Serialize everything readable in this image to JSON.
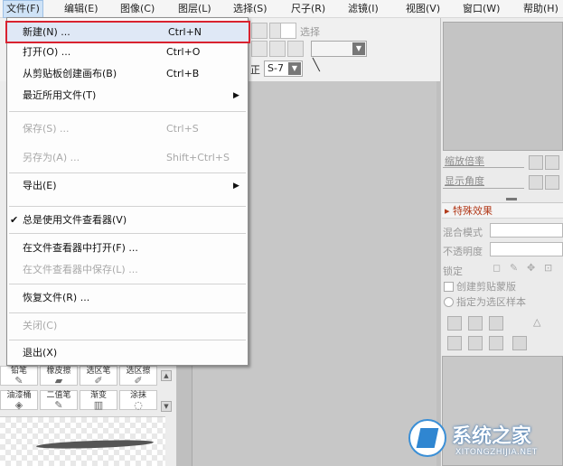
{
  "menubar": {
    "items": [
      "文件(F)",
      "编辑(E)",
      "图像(C)",
      "图层(L)",
      "选择(S)",
      "尺子(R)",
      "滤镜(I)",
      "视图(V)",
      "窗口(W)",
      "帮助(H)"
    ]
  },
  "toolbar": {
    "select_label": "选择",
    "zheng_label": "正",
    "size_value": "S-7"
  },
  "file_menu": {
    "items": [
      {
        "label": "新建(N) ...",
        "shortcut": "Ctrl+N",
        "state": "highlighted"
      },
      {
        "label": "打开(O) ...",
        "shortcut": "Ctrl+O",
        "state": "enabled"
      },
      {
        "label": "从剪贴板创建画布(B)",
        "shortcut": "Ctrl+B",
        "state": "enabled"
      },
      {
        "label": "最近所用文件(T)",
        "shortcut": "",
        "state": "submenu"
      },
      {
        "label": "保存(S) ...",
        "shortcut": "Ctrl+S",
        "state": "disabled"
      },
      {
        "label": "另存为(A) ...",
        "shortcut": "Shift+Ctrl+S",
        "state": "disabled"
      },
      {
        "label": "导出(E)",
        "shortcut": "",
        "state": "submenu"
      },
      {
        "label": "总是使用文件查看器(V)",
        "shortcut": "",
        "state": "checked"
      },
      {
        "label": "在文件查看器中打开(F) ...",
        "shortcut": "",
        "state": "enabled"
      },
      {
        "label": "在文件查看器中保存(L) ...",
        "shortcut": "",
        "state": "disabled"
      },
      {
        "label": "恢复文件(R) ...",
        "shortcut": "",
        "state": "enabled"
      },
      {
        "label": "关闭(C)",
        "shortcut": "",
        "state": "disabled"
      },
      {
        "label": "退出(X)",
        "shortcut": "",
        "state": "enabled"
      }
    ]
  },
  "navigator": {
    "zoom_label": "缩放倍率",
    "angle_label": "显示角度"
  },
  "layer_panel": {
    "effects_title": "特殊效果",
    "blend_mode_label": "混合模式",
    "opacity_label": "不透明度",
    "lock_label": "锁定",
    "clip_label": "创建剪贴蒙版",
    "selection_source_label": "指定为选区样本"
  },
  "tool_panel": {
    "row1": [
      "铅笔",
      "橡皮擦",
      "选区笔",
      "选区擦"
    ],
    "row2": [
      "油漆桶",
      "二值笔",
      "渐变",
      "涂抹"
    ]
  },
  "watermark": {
    "title": "系统之家",
    "subtitle": "XITONGZHIJIA.NET"
  }
}
